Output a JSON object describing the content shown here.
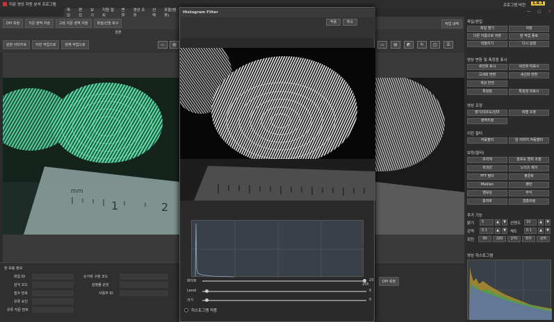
{
  "titlebar": {
    "title": "지문 영상 자동 분석 프로그램",
    "right_label": "프로그램 버전",
    "version": "1.0.3"
  },
  "menu": [
    "파일",
    "편집",
    "보기",
    "지원 절차",
    "변환",
    "영상 조정",
    "선택",
    "포함(범용)"
  ],
  "toolbar1": [
    "DPI 측정",
    "지문 영역 지정",
    "고정 지문 영역 지정",
    "화질/선명 복구"
  ],
  "sub_label": "원본",
  "toolbar2": [
    "원본 이미지로",
    "이전 작업으로",
    "현재 작업으로"
  ],
  "right_toolbar_label": "작업 내역",
  "panel": {
    "title": "현 보충 정보",
    "left_fields": [
      "파일 ID",
      "감식 코드",
      "접수 번호",
      "유류 요인",
      "유류 지문 번호"
    ],
    "mid_fields": [
      "손가락 구분 코드",
      "감정물 순번",
      "사용자 ID"
    ],
    "extra_label": "DPI 측정"
  },
  "dialog": {
    "title": "Histogram Filter",
    "ok": "적용",
    "cancel": "취소",
    "sliders": [
      {
        "label": "화이트",
        "v1": "23",
        "v2": "255",
        "pos": 0.98
      },
      {
        "label": "Level",
        "v1": "0",
        "pos": 0.02
      },
      {
        "label": "크기",
        "v1": "0",
        "pos": 0.02
      }
    ],
    "checkbox": "히스토그램 적용"
  },
  "right_panel": {
    "sec1": "파일/편집",
    "sec1_buttons": [
      "파일 열기",
      "저장",
      "다른 이름으로 저장",
      "현 작업 종료",
      "되돌리기",
      "다시 실행"
    ],
    "sec2": "영상 변환 및 측정점 표시",
    "sec2_buttons": [
      "세선화 표시",
      "세선화 미표시",
      "곡세화 변환",
      "세선화 변환",
      "색상 반전",
      "특징점",
      "특징점 미표시"
    ],
    "sec3": "영상 조정",
    "sec3_buttons": [
      "밝기/대조도/감마",
      "레벨 조정",
      "영역지정"
    ],
    "sec4": "이진 필터",
    "sec4_buttons": [
      "자동필터",
      "원 이미지 자동필터"
    ],
    "sec5": "보정(필터)",
    "sec5_buttons": [
      "초지게",
      "분포도 범위 조정",
      "외곽선",
      "노이즈 제거",
      "FFT 필터",
      "평준화",
      "Median",
      "평탄",
      "엠보싱",
      "부식",
      "흡착화",
      "겹흡흐림"
    ],
    "sec6": "추가 기능",
    "adj": [
      {
        "label": "밝기",
        "val": "5"
      },
      {
        "label": "선명도",
        "val": "10"
      },
      {
        "label": "강약",
        "val": "0.1"
      },
      {
        "label": "채도",
        "val": "0.1"
      }
    ],
    "rotate_label": "회전",
    "rotate": [
      "90",
      "180",
      "270",
      "좌우",
      "상하"
    ],
    "sec7": "영상 히스토그램"
  }
}
